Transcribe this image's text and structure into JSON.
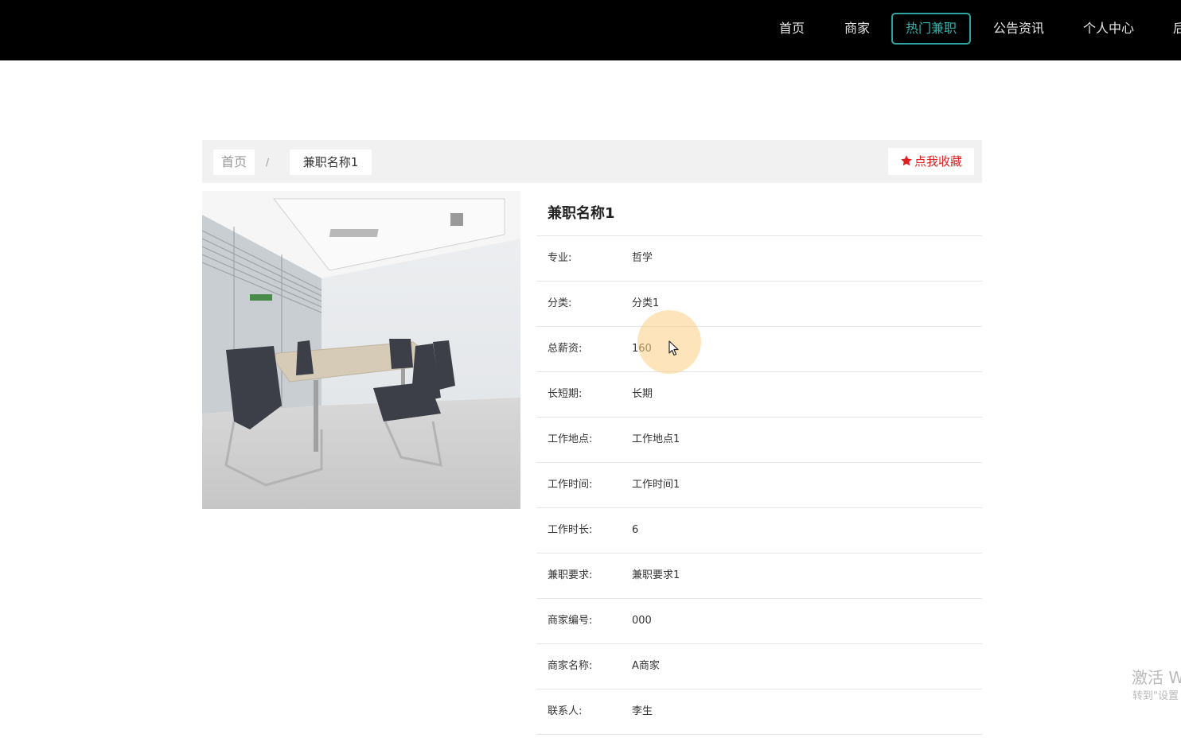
{
  "nav": {
    "items": [
      {
        "label": "首页",
        "active": false
      },
      {
        "label": "商家",
        "active": false
      },
      {
        "label": "热门兼职",
        "active": true
      },
      {
        "label": "公告资讯",
        "active": false
      },
      {
        "label": "个人中心",
        "active": false
      },
      {
        "label": "后",
        "active": false
      }
    ]
  },
  "breadcrumb": {
    "home": "首页",
    "separator": "/",
    "current": "兼职名称1"
  },
  "favorite_button": {
    "label": "点我收藏",
    "icon": "star-icon"
  },
  "photo": {
    "icon": "office-meeting-room-image"
  },
  "detail": {
    "title": "兼职名称1",
    "rows": [
      {
        "label": "专业:",
        "value": "哲学"
      },
      {
        "label": "分类:",
        "value": "分类1"
      },
      {
        "label": "总薪资:",
        "value": "160"
      },
      {
        "label": "长短期:",
        "value": "长期"
      },
      {
        "label": "工作地点:",
        "value": "工作地点1"
      },
      {
        "label": "工作时间:",
        "value": "工作时间1"
      },
      {
        "label": "工作时长:",
        "value": "6"
      },
      {
        "label": "兼职要求:",
        "value": "兼职要求1"
      },
      {
        "label": "商家编号:",
        "value": "000"
      },
      {
        "label": "商家名称:",
        "value": "A商家"
      },
      {
        "label": "联系人:",
        "value": "李生"
      }
    ]
  },
  "watermark": {
    "line1": "激活 W",
    "line2": "转到\"设置"
  },
  "colors": {
    "topbar": "#000000",
    "active_accent": "#2ea39f",
    "favorite": "#e02020",
    "breadcrumb_bg": "#f1f1f1"
  }
}
